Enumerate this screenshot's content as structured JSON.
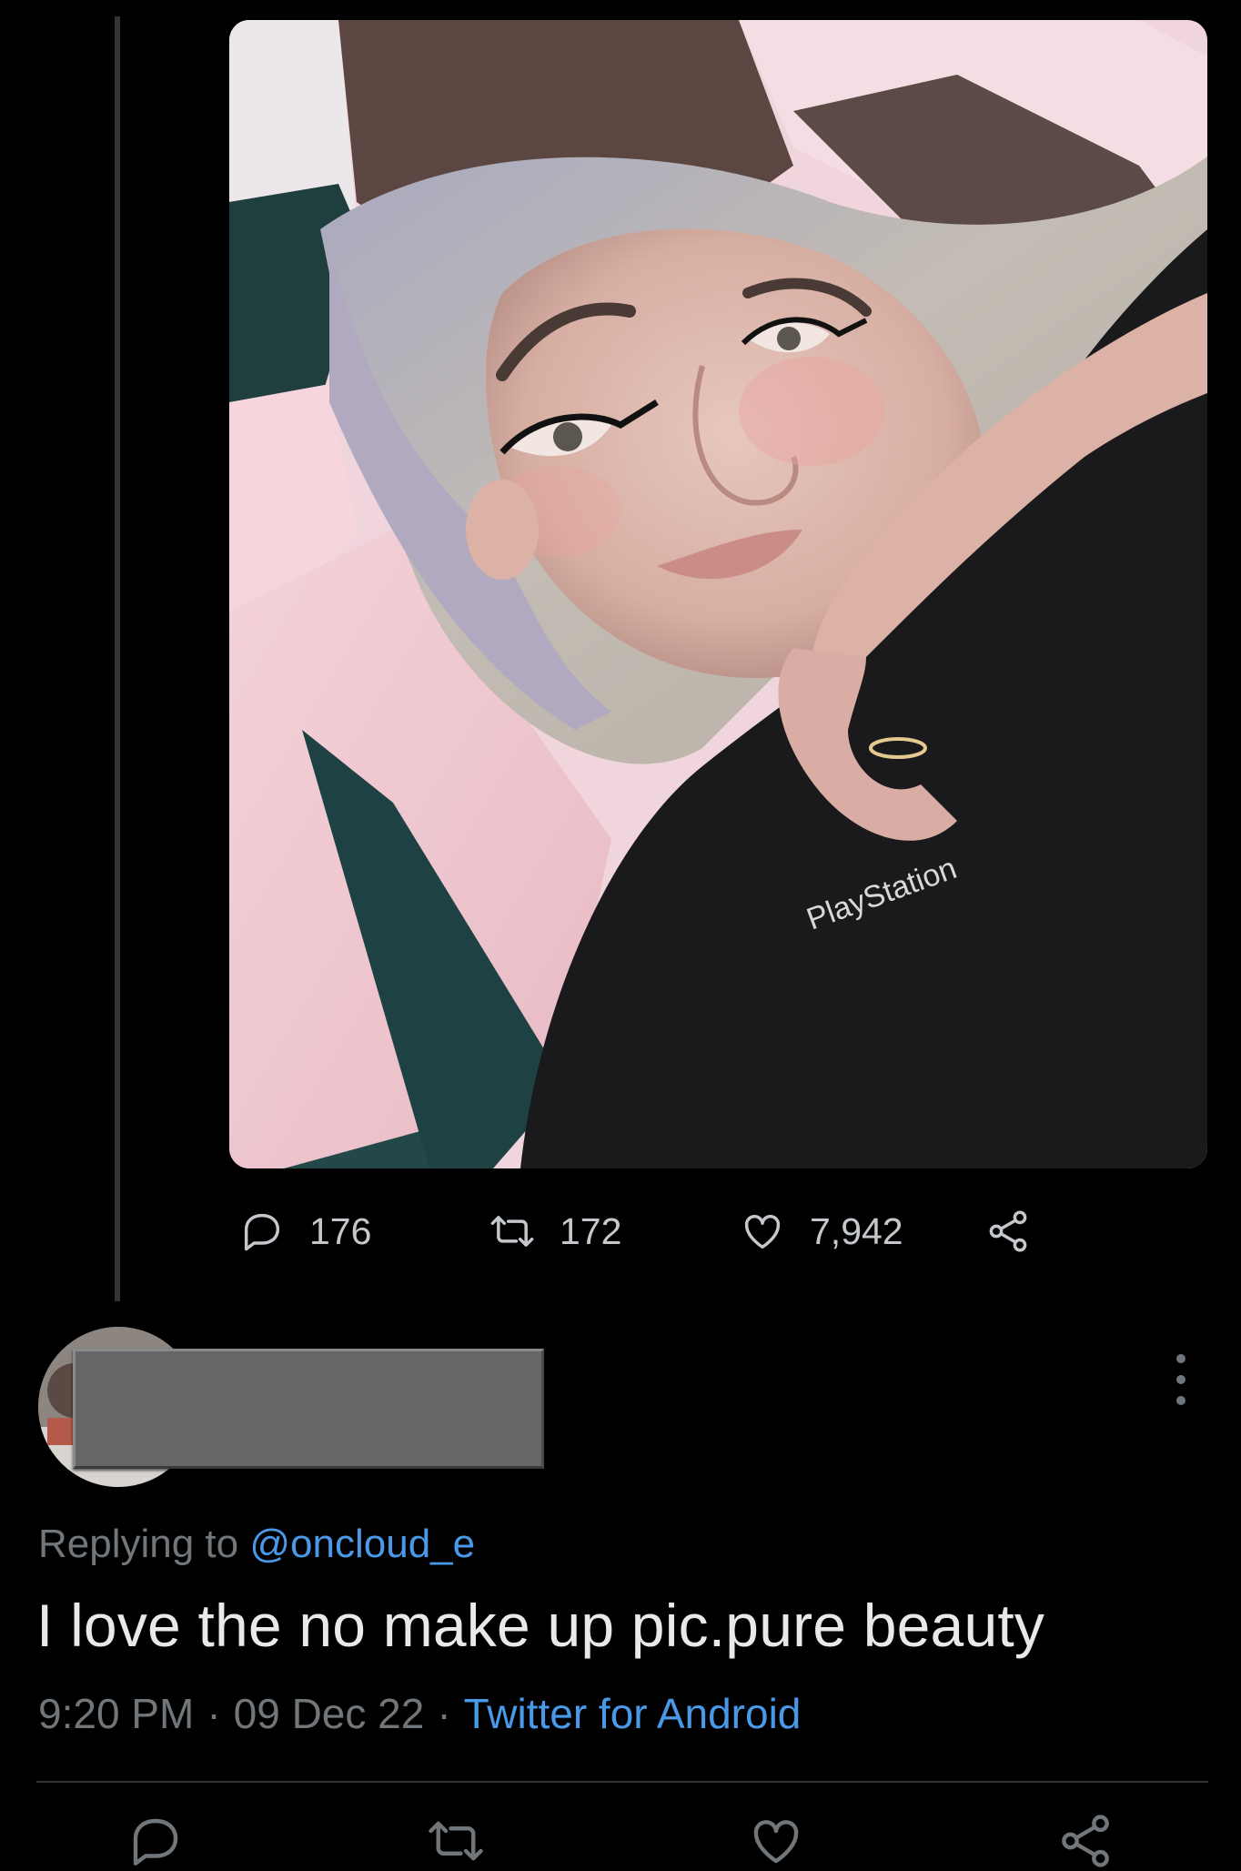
{
  "tweet_actions": {
    "reply_count": "176",
    "retweet_count": "172",
    "like_count": "7,942"
  },
  "media": {
    "alt": "Selfie photo",
    "shirt_text": "PlayStation"
  },
  "reply": {
    "replying_prefix": "Replying to",
    "replying_handle": "@oncloud_e",
    "text": "I love the no make up pic.pure beauty",
    "time": "9:20 PM",
    "date": "09 Dec 22",
    "source": "Twitter for Android",
    "separator": "·"
  },
  "icons": {
    "reply": "reply-icon",
    "retweet": "retweet-icon",
    "like": "heart-icon",
    "share": "share-icon",
    "more": "more-options-icon"
  },
  "colors": {
    "background": "#000000",
    "text_primary": "#e7e9ea",
    "text_secondary": "#71767b",
    "link": "#4a99e9",
    "divider": "#2f3336"
  }
}
